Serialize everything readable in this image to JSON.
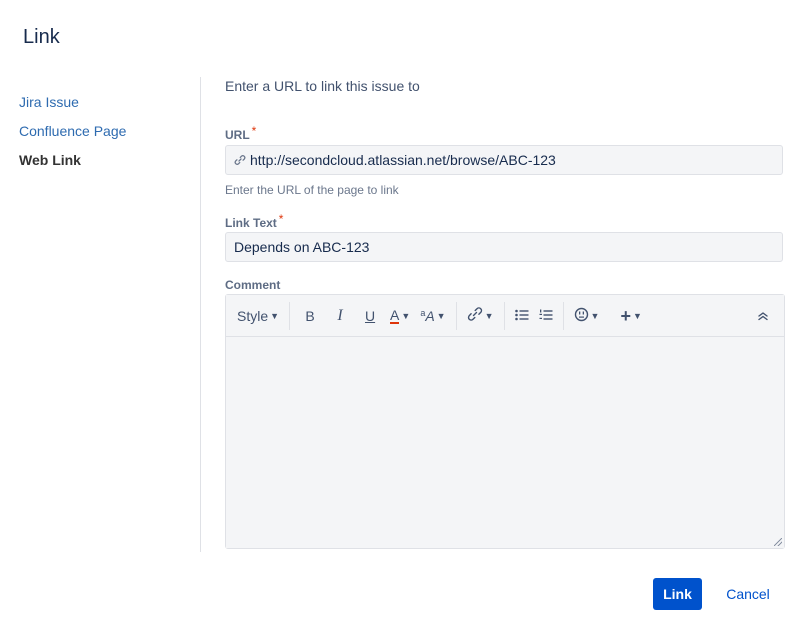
{
  "dialog": {
    "title": "Link"
  },
  "sidebar": {
    "items": [
      {
        "label": "Jira Issue"
      },
      {
        "label": "Confluence Page"
      },
      {
        "label": "Web Link"
      }
    ]
  },
  "main": {
    "intro": "Enter a URL to link this issue to",
    "url": {
      "label": "URL",
      "required_marker": "*",
      "value": "http://secondcloud.atlassian.net/browse/ABC-123",
      "hint": "Enter the URL of the page to link",
      "icon": "link-icon"
    },
    "link_text": {
      "label": "Link Text",
      "required_marker": "*",
      "value": "Depends on ABC-123"
    },
    "comment": {
      "label": "Comment",
      "toolbar": {
        "style_label": "Style",
        "bold": "B",
        "italic": "I",
        "underline": "U",
        "text_color": "A",
        "text_color_underline": "#de350b",
        "font_size": "A",
        "icons": [
          "link-icon",
          "bullet-list-icon",
          "numbered-list-icon",
          "emoticon-icon",
          "plus-icon",
          "collapse-icon"
        ]
      },
      "value": ""
    }
  },
  "footer": {
    "submit_label": "Link",
    "cancel_label": "Cancel"
  }
}
